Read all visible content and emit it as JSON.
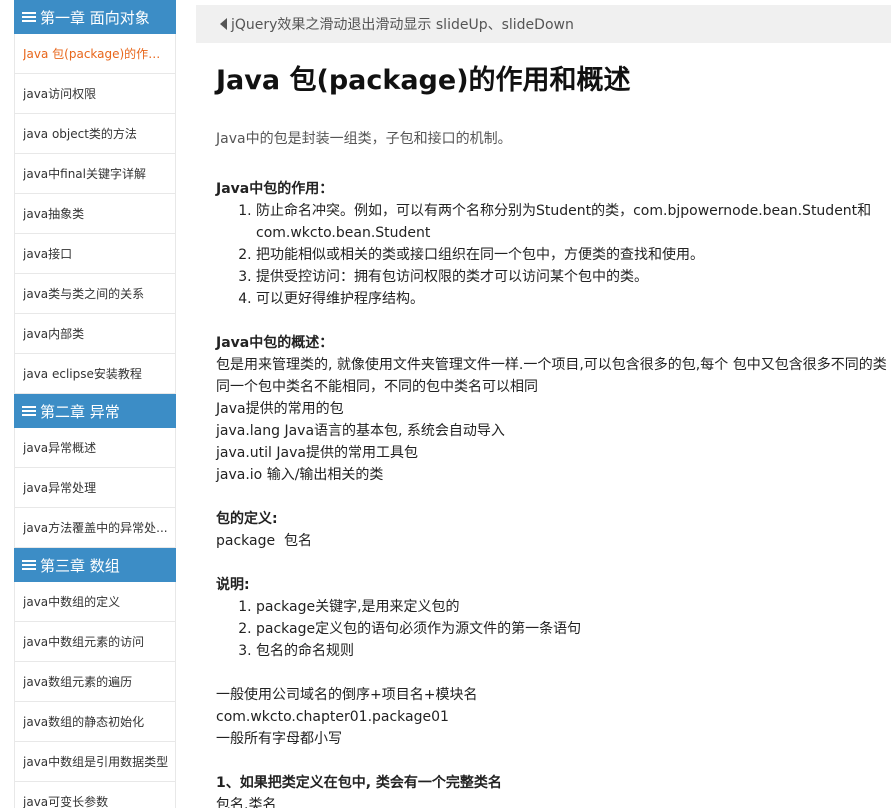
{
  "sidebar": {
    "chapters": [
      {
        "title": "第一章 面向对象",
        "items": [
          "Java 包(package)的作用...",
          "java访问权限",
          "java object类的方法",
          "java中final关键字详解",
          "java抽象类",
          "java接口",
          "java类与类之间的关系",
          "java内部类",
          "java eclipse安装教程"
        ]
      },
      {
        "title": "第二章 异常",
        "items": [
          "java异常概述",
          "java异常处理",
          "java方法覆盖中的异常处..."
        ]
      },
      {
        "title": "第三章 数组",
        "items": [
          "java中数组的定义",
          "java中数组元素的访问",
          "java数组元素的遍历",
          "java数组的静态初始化",
          "java中数组是引用数据类型",
          "java可变长参数"
        ]
      }
    ]
  },
  "main": {
    "prev_link": "jQuery效果之滑动退出滑动显示 slideUp、slideDown",
    "title": "Java 包(package)的作用和概述",
    "intro": "Java中的包是封装一组类，子包和接口的机制。",
    "role_heading": "Java中包的作用：",
    "role_items": [
      "防止命名冲突。例如，可以有两个名称分别为Student的类，com.bjpowernode.bean.Student和com.wkcto.bean.Student",
      "把功能相似或相关的类或接口组织在同一个包中，方便类的查找和使用。",
      "提供受控访问：拥有包访问权限的类才可以访问某个包中的类。",
      "可以更好得维护程序结构。"
    ],
    "overview_heading": "Java中包的概述：",
    "overview_lines": [
      "包是用来管理类的, 就像使用文件夹管理文件一样.一个项目,可以包含很多的包,每个 包中又包含很多不同的类",
      "同一个包中类名不能相同，不同的包中类名可以相同",
      "Java提供的常用的包",
      "java.lang Java语言的基本包, 系统会自动导入",
      "java.util Java提供的常用工具包",
      "java.io 输入/输出相关的类"
    ],
    "def_heading": "包的定义:",
    "def_line": "package  包名",
    "note_heading": "说明:",
    "note_items": [
      "package关键字,是用来定义包的",
      "package定义包的语句必须作为源文件的第一条语句",
      "包名的命名规则"
    ],
    "naming_lines": [
      "一般使用公司域名的倒序+项目名+模块名",
      "com.wkcto.chapter01.package01",
      "一般所有字母都小写"
    ],
    "point1_heading": "1、如果把类定义在包中, 类会有一个完整类名",
    "point1_line": "包名.类名"
  }
}
